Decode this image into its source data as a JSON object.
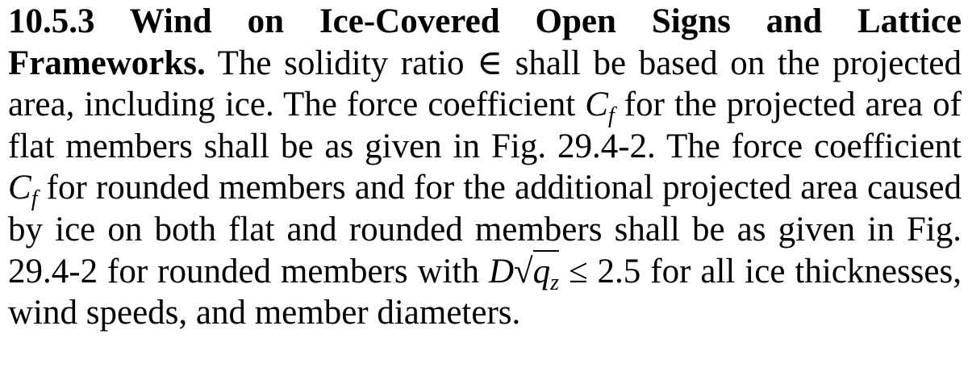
{
  "section": {
    "heading": "10.5.3 Wind on Ice-Covered Open Signs and Lattice Frameworks.",
    "text_1": " The solidity ratio ",
    "symbol_epsilon": "∈",
    "text_2": " shall be based on the projected area, including ice. The force coefficient ",
    "cf_1_main": "C",
    "cf_1_sub": "f",
    "text_3": " for the projected area of flat members shall be as given in Fig. 29.4-2. The force coefficient ",
    "cf_2_main": "C",
    "cf_2_sub": "f",
    "text_4": " for rounded members and for the additional projected area caused by ice on both flat and rounded members shall be as given in Fig. 29.4-2 for rounded members with ",
    "expr_d": "D",
    "expr_radical": "√",
    "expr_q": "q",
    "expr_q_sub": "z",
    "expr_rest": " ≤ 2.5",
    "text_5": " for all ice thicknesses, wind speeds, and member diameters."
  }
}
